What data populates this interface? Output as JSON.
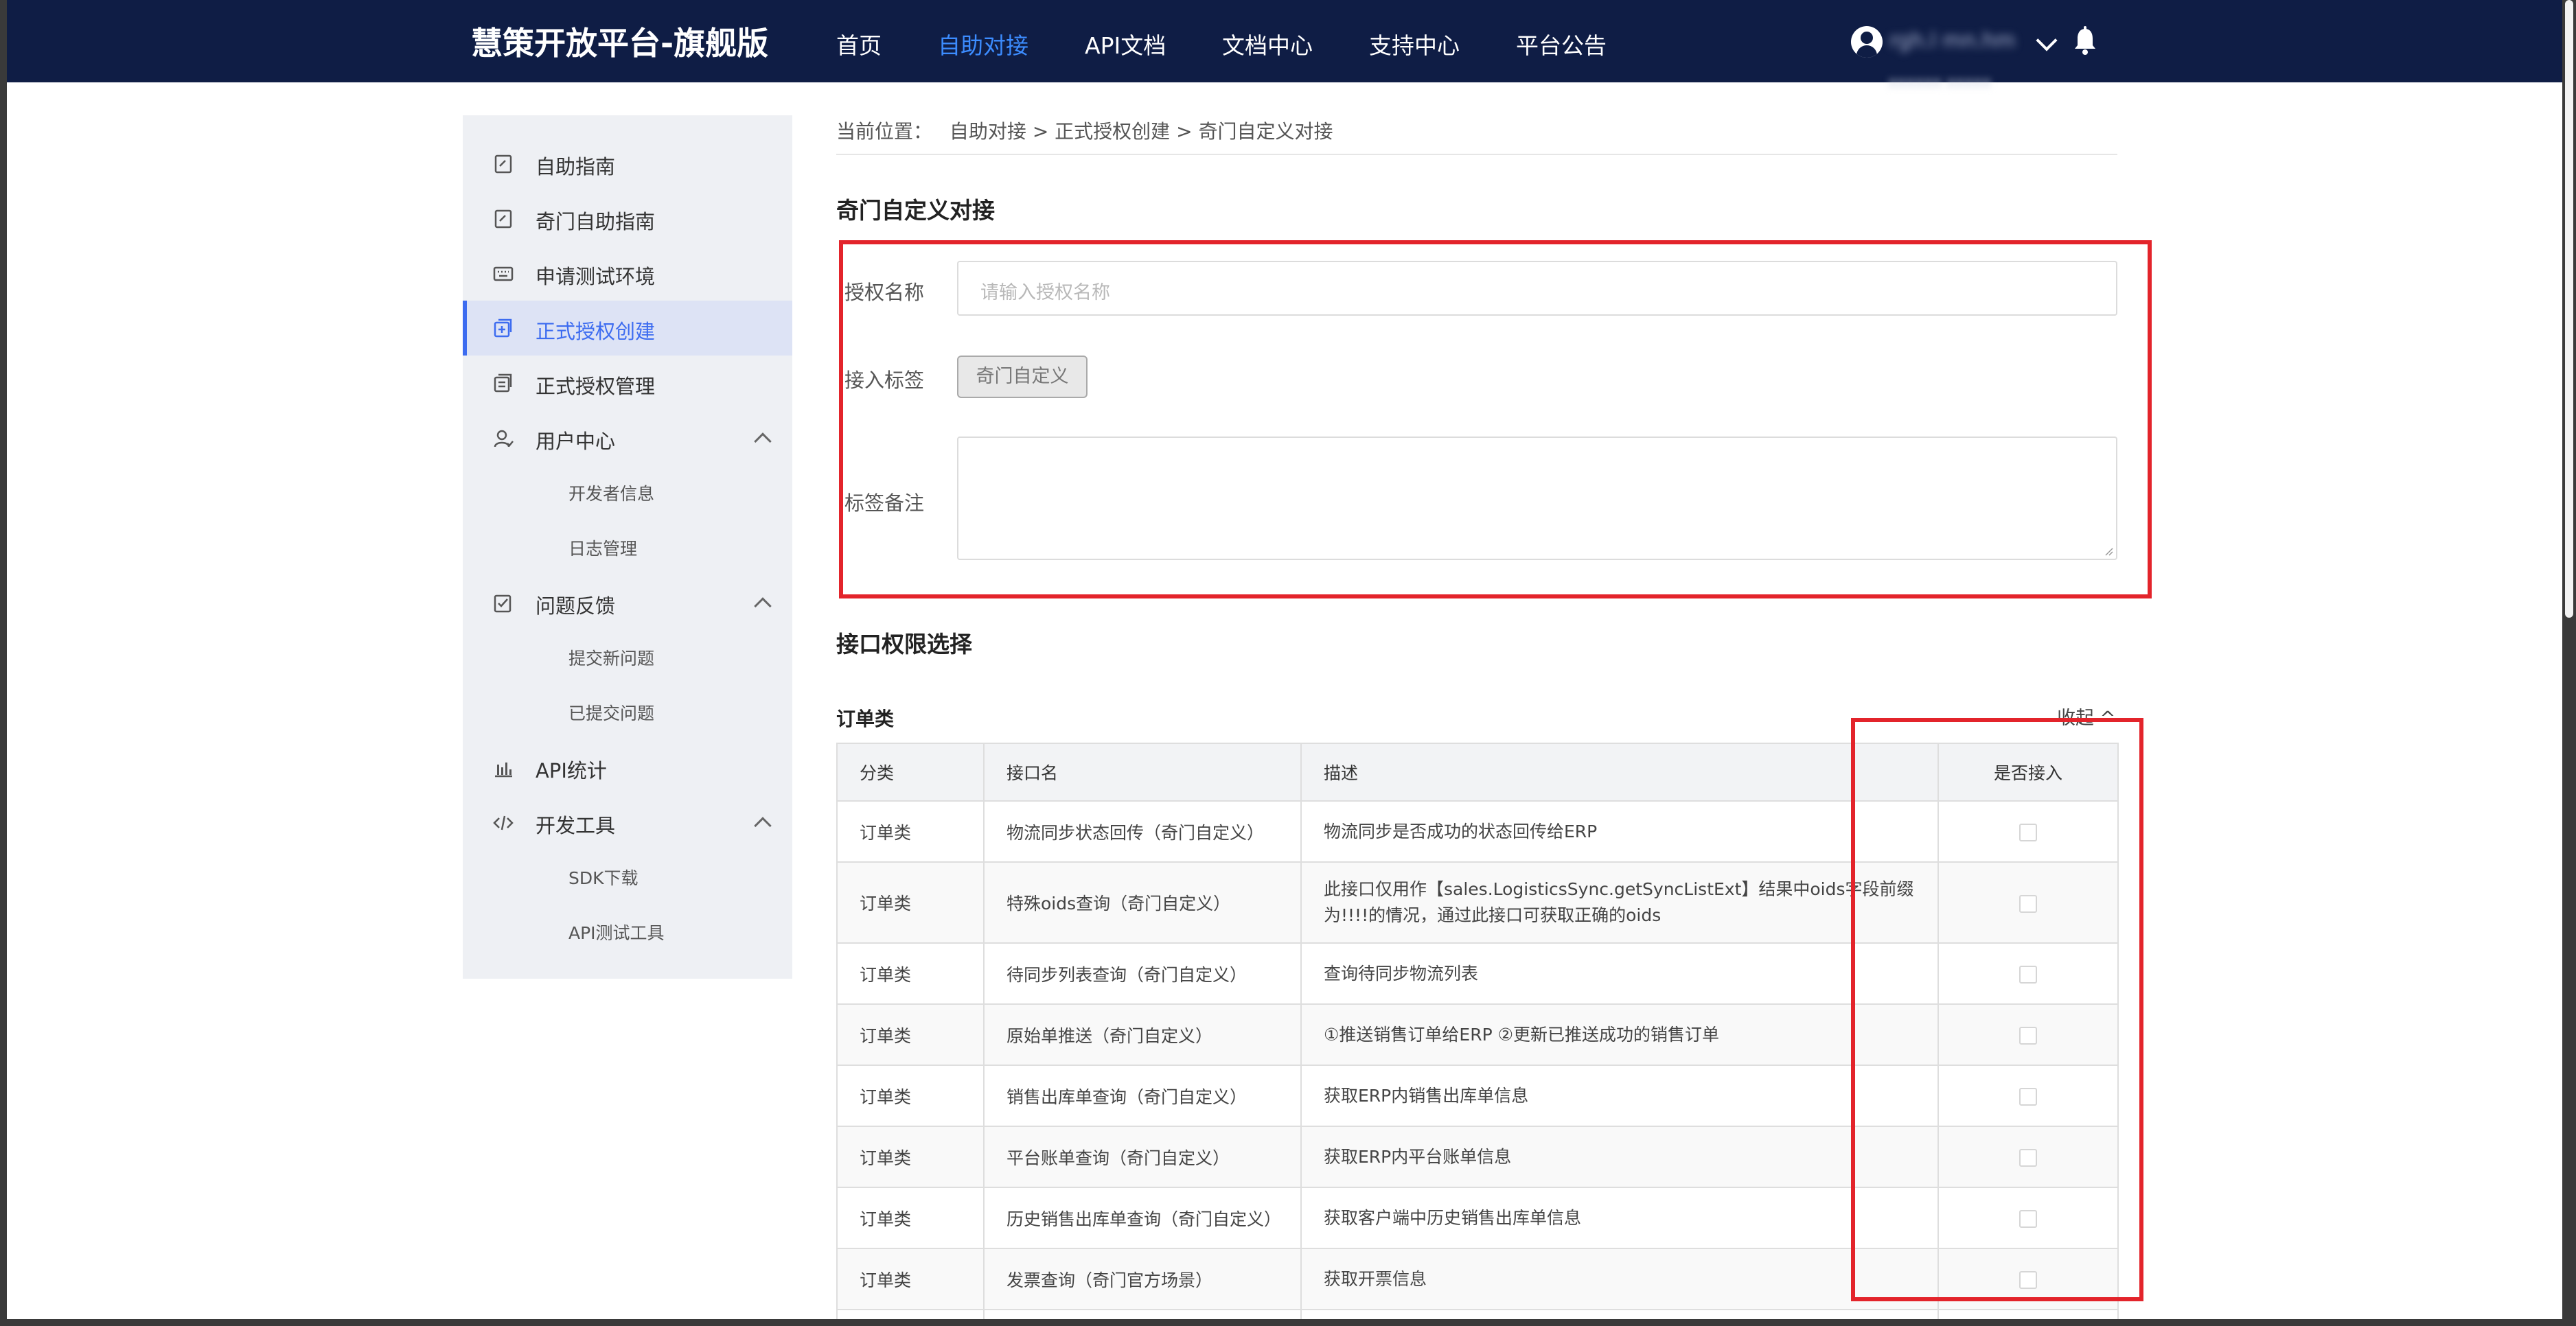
{
  "header": {
    "brand": "慧策开放平台-旗舰版",
    "nav": [
      {
        "label": "首页"
      },
      {
        "label": "自助对接",
        "active": true
      },
      {
        "label": "API文档"
      },
      {
        "label": "文档中心"
      },
      {
        "label": "支持中心"
      },
      {
        "label": "平台公告"
      }
    ],
    "user": {
      "name_blurred": "rgh.l mn.hm",
      "sub_blurred": "xxxxxx xxxxx"
    },
    "colors": {
      "bar": "#0f1d45",
      "active": "#3c8cff"
    }
  },
  "sidebar": {
    "items": [
      {
        "label": "自助指南",
        "icon": "guide-icon"
      },
      {
        "label": "奇门自助指南",
        "icon": "guide-icon"
      },
      {
        "label": "申请测试环境",
        "icon": "keyboard-icon"
      },
      {
        "label": "正式授权创建",
        "icon": "create-icon",
        "active": true
      },
      {
        "label": "正式授权管理",
        "icon": "manage-icon"
      },
      {
        "label": "用户中心",
        "icon": "user-icon",
        "expanded": true,
        "children": [
          "开发者信息",
          "日志管理"
        ]
      },
      {
        "label": "问题反馈",
        "icon": "feedback-icon",
        "expanded": true,
        "children": [
          "提交新问题",
          "已提交问题"
        ]
      },
      {
        "label": "API统计",
        "icon": "chart-icon"
      },
      {
        "label": "开发工具",
        "icon": "code-icon",
        "expanded": true,
        "children": [
          "SDK下载",
          "API测试工具"
        ]
      }
    ],
    "active_color": "#3d6cf0"
  },
  "breadcrumb": {
    "prefix": "当前位置：",
    "path": "自助对接 > 正式授权创建 > 奇门自定义对接"
  },
  "form": {
    "title": "奇门自定义对接",
    "name_label": "授权名称",
    "name_placeholder": "请输入授权名称",
    "name_value": "",
    "tag_label": "接入标签",
    "tag_value": "奇门自定义",
    "remark_label": "标签备注",
    "remark_value": ""
  },
  "permissions": {
    "title": "接口权限选择",
    "group": "订单类",
    "collapse_label": "收起 ^",
    "columns": [
      "分类",
      "接口名",
      "描述",
      "是否接入"
    ],
    "rows": [
      {
        "category": "订单类",
        "name": "物流同步状态回传（奇门自定义）",
        "desc": "物流同步是否成功的状态回传给ERP",
        "checked": false
      },
      {
        "category": "订单类",
        "name": "特殊oids查询（奇门自定义）",
        "desc": "此接口仅用作【sales.LogisticsSync.getSyncListExt】结果中oids字段前缀为!!!!的情况，通过此接口可获取正确的oids",
        "checked": false
      },
      {
        "category": "订单类",
        "name": "待同步列表查询（奇门自定义）",
        "desc": "查询待同步物流列表",
        "checked": false
      },
      {
        "category": "订单类",
        "name": "原始单推送（奇门自定义）",
        "desc": "①推送销售订单给ERP ②更新已推送成功的销售订单",
        "checked": false
      },
      {
        "category": "订单类",
        "name": "销售出库单查询（奇门自定义）",
        "desc": "获取ERP内销售出库单信息",
        "checked": false
      },
      {
        "category": "订单类",
        "name": "平台账单查询（奇门自定义）",
        "desc": "获取ERP内平台账单信息",
        "checked": false
      },
      {
        "category": "订单类",
        "name": "历史销售出库单查询（奇门自定义）",
        "desc": "获取客户端中历史销售出库单信息",
        "checked": false
      },
      {
        "category": "订单类",
        "name": "发票查询（奇门官方场景）",
        "desc": "获取开票信息",
        "checked": false
      }
    ]
  },
  "highlight_color": "#e3242b"
}
